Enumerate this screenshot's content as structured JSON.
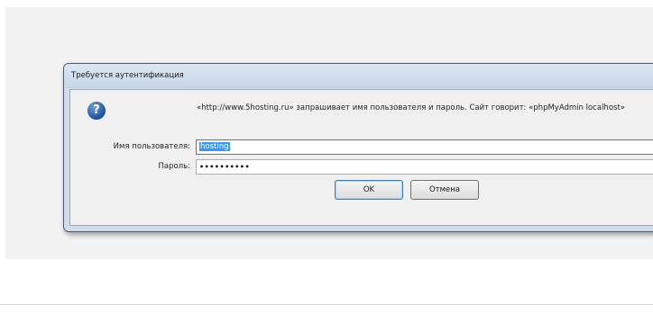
{
  "dialog": {
    "title": "Требуется аутентификация",
    "icon": "question-icon",
    "message": "«http://www.5hosting.ru» запрашивает имя пользователя и пароль. Сайт говорит: «phpMyAdmin localhost»",
    "username_label": "Имя пользователя:",
    "username_value": "hosting",
    "password_label": "Пароль:",
    "password_value": "••••••••••",
    "ok_label": "OK",
    "cancel_label": "Отмена"
  },
  "colors": {
    "frame": "#cfdcea",
    "selection": "#3399ff",
    "icon": "#1e4f98"
  }
}
